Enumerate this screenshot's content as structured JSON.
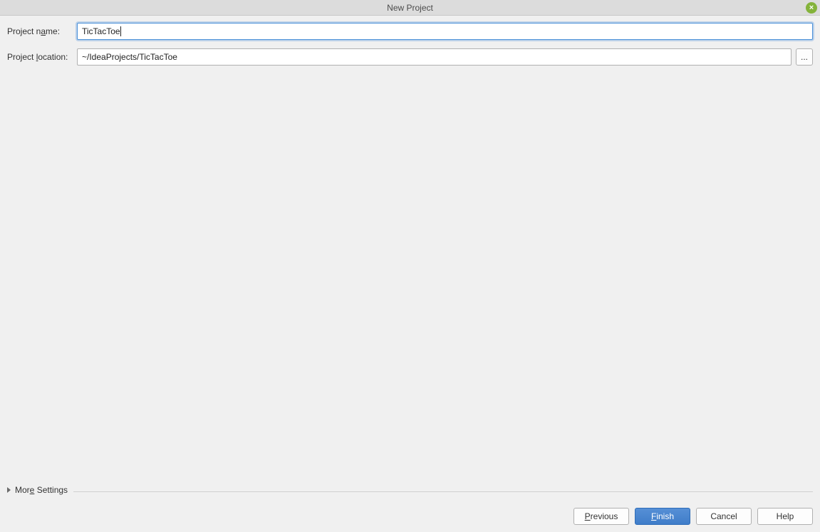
{
  "window": {
    "title": "New Project"
  },
  "form": {
    "project_name_label_pre": "Project n",
    "project_name_label_mn": "a",
    "project_name_label_post": "me:",
    "project_name_value": "TicTacToe",
    "project_location_label_pre": "Project ",
    "project_location_label_mn": "l",
    "project_location_label_post": "ocation:",
    "project_location_value": "~/IdeaProjects/TicTacToe",
    "browse_label": "..."
  },
  "more_settings": {
    "label_pre": "Mor",
    "label_mn": "e",
    "label_post": " Settings"
  },
  "buttons": {
    "previous_pre": "",
    "previous_mn": "P",
    "previous_post": "revious",
    "finish_pre": "",
    "finish_mn": "F",
    "finish_post": "inish",
    "cancel": "Cancel",
    "help": "Help"
  }
}
